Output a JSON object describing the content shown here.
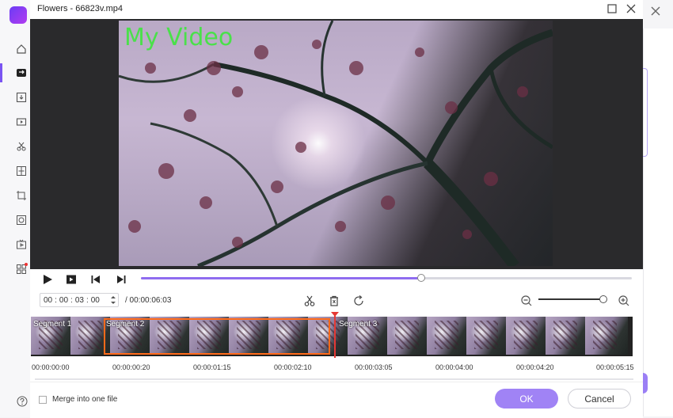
{
  "dialog": {
    "title": "Flowers - 66823v.mp4",
    "overlay_text": "My Video",
    "player": {
      "progress_fraction": 0.57
    },
    "time_input": {
      "h": "00",
      "m": "00",
      "s": "03",
      "f": "00",
      "sep": ":"
    },
    "total_time": "/ 00:00:06:03",
    "zoom_fraction": 0.92,
    "segments": [
      {
        "label": "Segment 1"
      },
      {
        "label": "Segment 2"
      },
      {
        "label": "Segment 3"
      }
    ],
    "ruler": [
      "00:00:00:00",
      "00:00:00:20",
      "00:00:01:15",
      "00:00:02:10",
      "00:00:03:05",
      "00:00:04:00",
      "00:00:04:20",
      "00:00:05:15"
    ],
    "merge_label": "Merge into one file",
    "ok_label": "OK",
    "cancel_label": "Cancel"
  },
  "colors": {
    "accent": "#8f6cf0",
    "ok": "#a083f5",
    "selection": "#ff6a1a",
    "playhead": "#e53935",
    "overlay_text": "#4ae04a"
  },
  "sidebar_icons": [
    "home-icon",
    "convert-icon",
    "download-icon",
    "record-icon",
    "cut-icon",
    "merge-icon",
    "crop-icon",
    "dvd-icon",
    "tv-icon",
    "toolbox-icon",
    "help-icon"
  ]
}
